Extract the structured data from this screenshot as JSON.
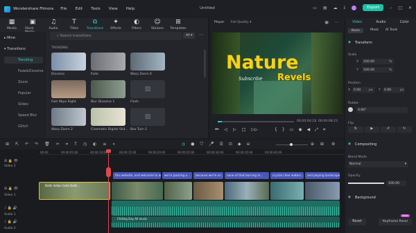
{
  "app": {
    "name": "Wondershare Filmora",
    "doc_title": "Untitled",
    "export_label": "Export",
    "menu": [
      "File",
      "Edit",
      "Tools",
      "View",
      "Help"
    ]
  },
  "media_tabs": [
    {
      "label": "Media",
      "icon": "folder-icon"
    },
    {
      "label": "Stock Media",
      "icon": "stock-icon"
    },
    {
      "label": "Audio",
      "icon": "music-icon"
    },
    {
      "label": "Titles",
      "icon": "text-icon"
    },
    {
      "label": "Transitions",
      "icon": "transition-icon"
    },
    {
      "label": "Effects",
      "icon": "effects-icon"
    },
    {
      "label": "Filters",
      "icon": "filter-icon"
    },
    {
      "label": "Stickers",
      "icon": "sticker-icon"
    },
    {
      "label": "Templates",
      "icon": "template-icon"
    }
  ],
  "sidebar": {
    "items": [
      "Mine",
      "Transitions",
      "Trending",
      "Fade&Dissolve",
      "Zoom",
      "Popular",
      "Slides",
      "Speed Blur",
      "Glitch"
    ]
  },
  "search": {
    "placeholder": "Search transitions",
    "filter": "All"
  },
  "section_title": "TRENDING",
  "thumbnails": [
    "Dissolve",
    "Fade",
    "Warp Zoom 6",
    "Fast Wipe Right",
    "Blur Dissolve 1",
    "Flash",
    "Warp Zoom 2",
    "Cinematic Digital Slid...",
    "Box Turn 1"
  ],
  "player": {
    "label": "Player",
    "quality": "Full Quality",
    "title_big": "Nature",
    "title_sub": "Revels",
    "subscribe": "Subscribe",
    "current_time": "00:00:04:23",
    "total_time": "00:00:08:23",
    "progress": 0.05
  },
  "props": {
    "tabs": [
      "Video",
      "Audio",
      "Color"
    ],
    "subtabs": [
      "Basic",
      "Mask",
      "AI Tools"
    ],
    "transform": "Transform",
    "scale": "Scale",
    "x_label": "X",
    "y_label": "Y",
    "scale_x": "100.00",
    "scale_y": "100.00",
    "pct": "%",
    "position": "Position",
    "pos_x": "0.00",
    "pos_y": "0.00",
    "px": "px",
    "rotate": "Rotate",
    "rotate_val": "0.00°",
    "flip": "Flip",
    "compositing": "Compositing",
    "blend_mode": "Blend Mode",
    "blend_val": "Normal",
    "opacity": "Opacity",
    "opacity_val": "100.00",
    "opacity_level": 1.0,
    "background": "Background",
    "reset": "Reset",
    "keyframe": "Keyframe Panel",
    "new_badge": "NEW"
  },
  "timeline": {
    "ruler": [
      "00:00",
      "00:00:05:00",
      "00:00:10:00",
      "00:00:15:00",
      "00:00:20:00",
      "00:00:25:00",
      "00:00:30:00",
      "00:00:35:00",
      "00:00:40:00"
    ],
    "text_clips": [
      "this website, and welcome to an...",
      "we're packing u...",
      "because we're on...",
      "none of that burning m...",
      "crystal clear waters...",
      "and playing landscape..."
    ],
    "video_first": "Delhi Indian Gate Delhi...",
    "audio_title": "Chilling Day All music",
    "tracks": [
      "Video 2",
      "Video 1",
      "Audio 1",
      "Audio 2"
    ]
  }
}
